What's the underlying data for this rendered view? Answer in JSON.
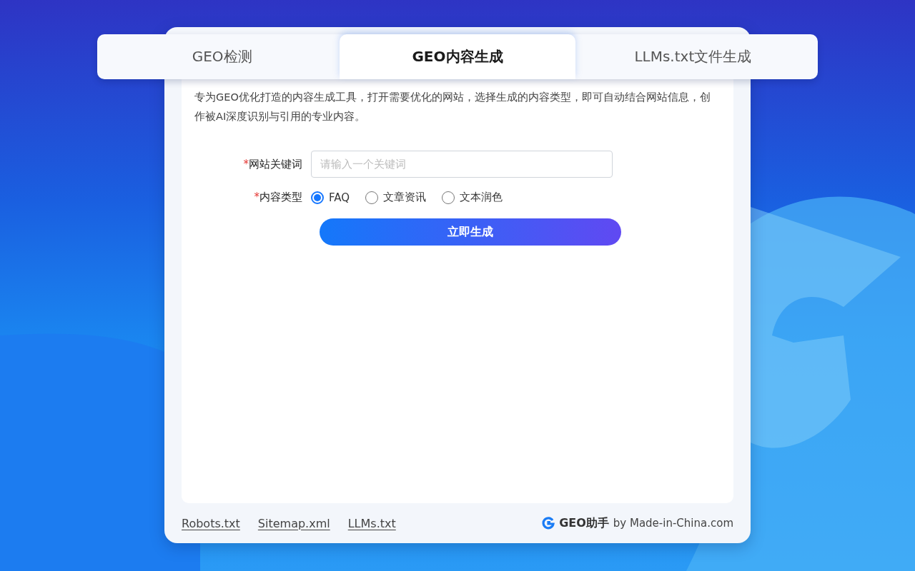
{
  "tabs": [
    {
      "label": "GEO检测",
      "selected": false
    },
    {
      "label": "GEO内容生成",
      "selected": true
    },
    {
      "label": "LLMs.txt文件生成",
      "selected": false
    }
  ],
  "description": "专为GEO优化打造的内容生成工具，打开需要优化的网站，选择生成的内容类型，即可自动结合网站信息，创作被AI深度识别与引用的专业内容。",
  "form": {
    "keyword": {
      "required_mark": "*",
      "label": "网站关键词",
      "placeholder": "请输入一个关键词"
    },
    "content_type": {
      "required_mark": "*",
      "label": "内容类型",
      "options": [
        {
          "label": "FAQ",
          "selected": true
        },
        {
          "label": "文章资讯",
          "selected": false
        },
        {
          "label": "文本润色",
          "selected": false
        }
      ]
    },
    "submit": "立即生成"
  },
  "footer": {
    "links": [
      "Robots.txt",
      "Sitemap.xml",
      "LLMs.txt"
    ],
    "brand": "GEO助手",
    "byline": "by Made-in-China.com"
  }
}
